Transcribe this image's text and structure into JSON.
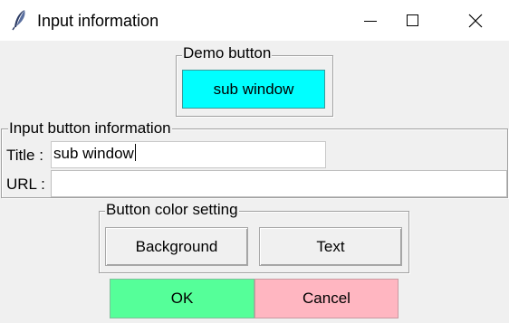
{
  "window": {
    "title": "Input information",
    "icon": "feather-icon",
    "controls": [
      "minimize-icon",
      "maximize-icon",
      "close-icon"
    ]
  },
  "demo_group": {
    "label": "Demo button",
    "button_label": "sub window",
    "button_color": "#00ffff"
  },
  "info_group": {
    "label": "Input button information",
    "title_label": "Title :",
    "title_value": "sub window",
    "url_label": "URL :",
    "url_value": ""
  },
  "color_group": {
    "label": "Button color setting",
    "background_label": "Background",
    "text_label": "Text"
  },
  "actions": {
    "ok_label": "OK",
    "ok_color": "#55ff99",
    "cancel_label": "Cancel",
    "cancel_color": "#ffb6c1"
  }
}
